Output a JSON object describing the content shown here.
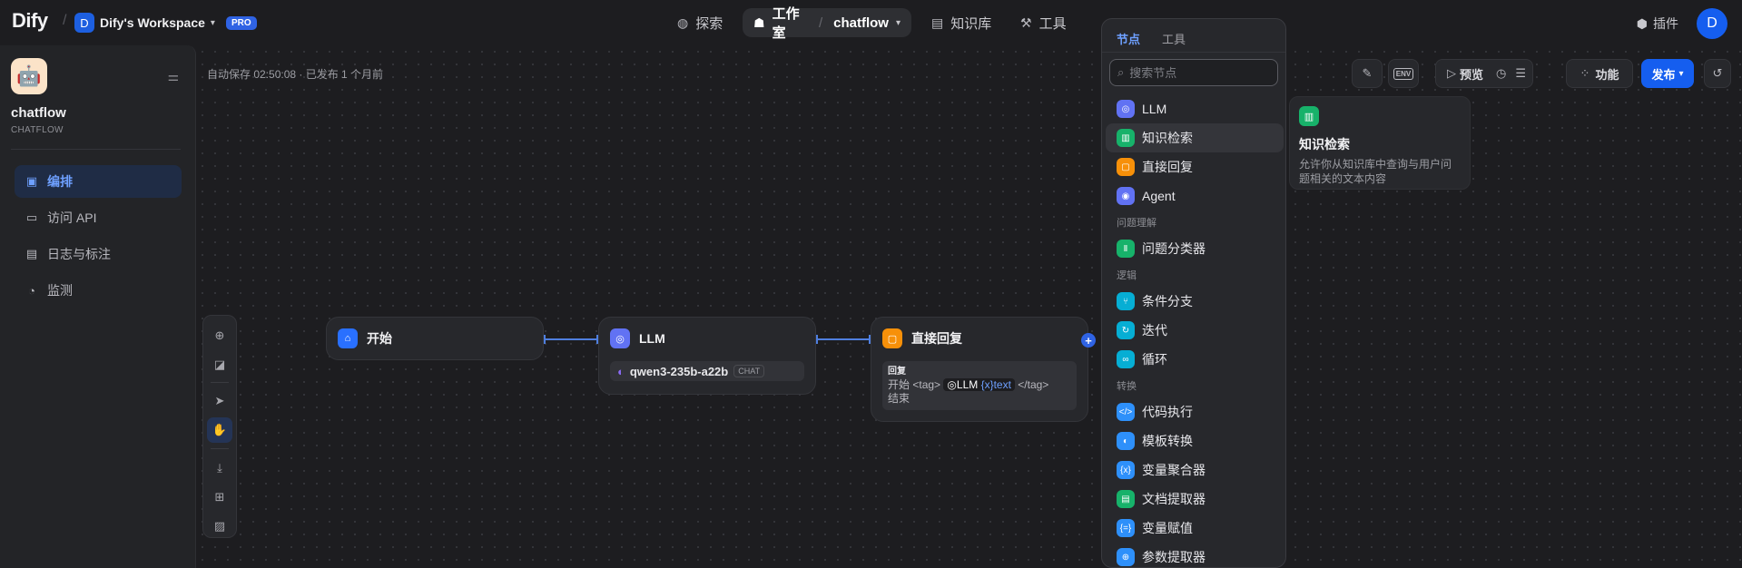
{
  "header": {
    "logo": "Dify",
    "workspace": {
      "initial": "D",
      "name": "Dify's Workspace",
      "badge": "PRO"
    },
    "nav": {
      "explore": "探索",
      "studio": "工作室",
      "app": "chatflow",
      "knowledge": "知识库",
      "tools": "工具"
    },
    "plugins": "插件",
    "user_initial": "D"
  },
  "sidebar": {
    "app_name": "chatflow",
    "app_type": "CHATFLOW",
    "items": [
      {
        "label": "编排",
        "icon": "layout-icon",
        "active": true
      },
      {
        "label": "访问 API",
        "icon": "terminal-icon"
      },
      {
        "label": "日志与标注",
        "icon": "file-list-icon"
      },
      {
        "label": "监测",
        "icon": "gauge-icon"
      }
    ]
  },
  "canvas": {
    "autosave": "自动保存 02:50:08 · 已发布 1 个月前",
    "nodes": {
      "start": {
        "title": "开始",
        "color": "#2970ff"
      },
      "llm": {
        "title": "LLM",
        "model": "qwen3-235b-a22b",
        "model_tag": "CHAT",
        "color": "#6172f3"
      },
      "answer": {
        "title": "直接回复",
        "color": "#f79009",
        "reply_label": "回复",
        "text_start": "开始",
        "tag_open": "<tag>",
        "var_node": "LLM",
        "var_name": "text",
        "tag_close": "</tag>",
        "text_end": "结束"
      }
    }
  },
  "controls": {
    "env": "ENV",
    "preview": "预览",
    "features": "功能",
    "publish": "发布"
  },
  "picker": {
    "tabs": [
      "节点",
      "工具"
    ],
    "search_placeholder": "搜索节点",
    "items": [
      {
        "label": "LLM",
        "color": "#6172f3",
        "glyph": "◎"
      },
      {
        "label": "知识检索",
        "color": "#17b26a",
        "glyph": "▥",
        "hover": true
      },
      {
        "label": "直接回复",
        "color": "#f79009",
        "glyph": "▢"
      },
      {
        "label": "Agent",
        "color": "#6172f3",
        "glyph": "◉"
      }
    ],
    "sections": [
      {
        "title": "问题理解",
        "items": [
          {
            "label": "问题分类器",
            "color": "#17b26a",
            "glyph": "Ⅱ"
          }
        ]
      },
      {
        "title": "逻辑",
        "items": [
          {
            "label": "条件分支",
            "color": "#06aed4",
            "glyph": "⑂"
          },
          {
            "label": "迭代",
            "color": "#06aed4",
            "glyph": "↻"
          },
          {
            "label": "循环",
            "color": "#06aed4",
            "glyph": "∞"
          }
        ]
      },
      {
        "title": "转换",
        "items": [
          {
            "label": "代码执行",
            "color": "#2e90fa",
            "glyph": "</>"
          },
          {
            "label": "模板转换",
            "color": "#2e90fa",
            "glyph": "◐"
          },
          {
            "label": "变量聚合器",
            "color": "#2e90fa",
            "glyph": "{x}"
          },
          {
            "label": "文档提取器",
            "color": "#17b26a",
            "glyph": "▤"
          },
          {
            "label": "变量赋值",
            "color": "#2e90fa",
            "glyph": "{=}"
          },
          {
            "label": "参数提取器",
            "color": "#2e90fa",
            "glyph": "⊕"
          }
        ]
      }
    ]
  },
  "tooltip": {
    "title": "知识检索",
    "description": "允许你从知识库中查询与用户问题相关的文本内容"
  }
}
